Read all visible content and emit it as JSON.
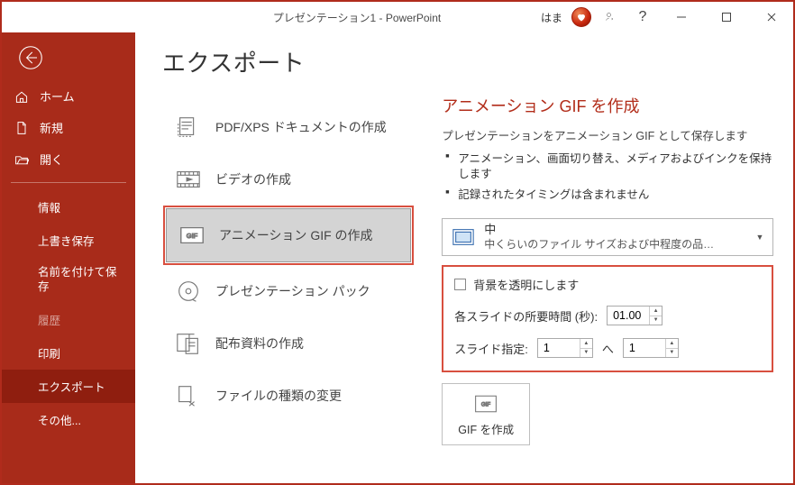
{
  "titlebar": {
    "title": "プレゼンテーション1  -  PowerPoint",
    "user": "はま"
  },
  "sidebar": {
    "home": "ホーム",
    "new": "新規",
    "open": "開く",
    "subs": [
      "情報",
      "上書き保存",
      "名前を付けて保存",
      "履歴",
      "印刷",
      "エクスポート",
      "その他..."
    ]
  },
  "page": {
    "title": "エクスポート"
  },
  "export_items": [
    {
      "label": "PDF/XPS ドキュメントの作成"
    },
    {
      "label": "ビデオの作成"
    },
    {
      "label": "アニメーション GIF の作成"
    },
    {
      "label": "プレゼンテーション パック"
    },
    {
      "label": "配布資料の作成"
    },
    {
      "label": "ファイルの種類の変更"
    }
  ],
  "detail": {
    "title": "アニメーション GIF を作成",
    "subtitle": "プレゼンテーションをアニメーション GIF として保存します",
    "bullets": [
      "アニメーション、画面切り替え、メディアおよびインクを保持します",
      "記録されたタイミングは含まれません"
    ],
    "quality": {
      "line1": "中",
      "line2": "中くらいのファイル サイズおよび中程度の品…"
    },
    "transparent_label": "背景を透明にします",
    "duration_label": "各スライドの所要時間 (秒):",
    "duration_value": "01.00",
    "range_label": "スライド指定:",
    "range_from": "1",
    "range_sep": "へ",
    "range_to": "1",
    "create_label": "GIF を作成"
  }
}
